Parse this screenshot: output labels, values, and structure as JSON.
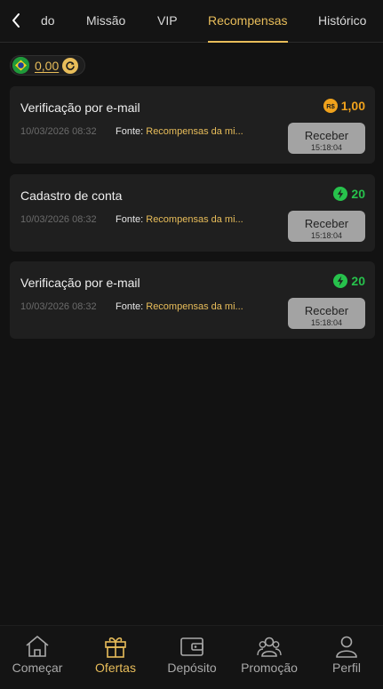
{
  "header": {
    "tabs": [
      {
        "label": "do",
        "active": false
      },
      {
        "label": "Missão",
        "active": false
      },
      {
        "label": "VIP",
        "active": false
      },
      {
        "label": "Recompensas",
        "active": true
      },
      {
        "label": "Histórico",
        "active": false
      }
    ]
  },
  "balance": {
    "amount": "0,00",
    "flag_icon": "brazil-flag-icon",
    "refresh_icon": "refresh-icon"
  },
  "rewards": [
    {
      "title": "Verificação por e-mail",
      "date": "10/03/2026 08:32",
      "source_label": "Fonte:",
      "source_value": "Recompensas da mi...",
      "reward_icon": "real-coin-icon",
      "reward_value": "1,00",
      "reward_color": "#f0a21c",
      "claim_label": "Receber",
      "claim_timer": "15:18:04"
    },
    {
      "title": "Cadastro de conta",
      "date": "10/03/2026 08:32",
      "source_label": "Fonte:",
      "source_value": "Recompensas da mi...",
      "reward_icon": "lightning-icon",
      "reward_value": "20",
      "reward_color": "#27c24c",
      "claim_label": "Receber",
      "claim_timer": "15:18:04"
    },
    {
      "title": "Verificação por e-mail",
      "date": "10/03/2026 08:32",
      "source_label": "Fonte:",
      "source_value": "Recompensas da mi...",
      "reward_icon": "lightning-icon",
      "reward_value": "20",
      "reward_color": "#27c24c",
      "claim_label": "Receber",
      "claim_timer": "15:18:04"
    }
  ],
  "bottom_nav": [
    {
      "label": "Começar",
      "icon": "home-icon",
      "active": false
    },
    {
      "label": "Ofertas",
      "icon": "gift-icon",
      "active": true
    },
    {
      "label": "Depósito",
      "icon": "wallet-icon",
      "active": false
    },
    {
      "label": "Promoção",
      "icon": "people-icon",
      "active": false
    },
    {
      "label": "Perfil",
      "icon": "user-icon",
      "active": false
    }
  ],
  "colors": {
    "accent": "#e8bd5a",
    "background": "#121212",
    "card": "#1f1f1f"
  }
}
